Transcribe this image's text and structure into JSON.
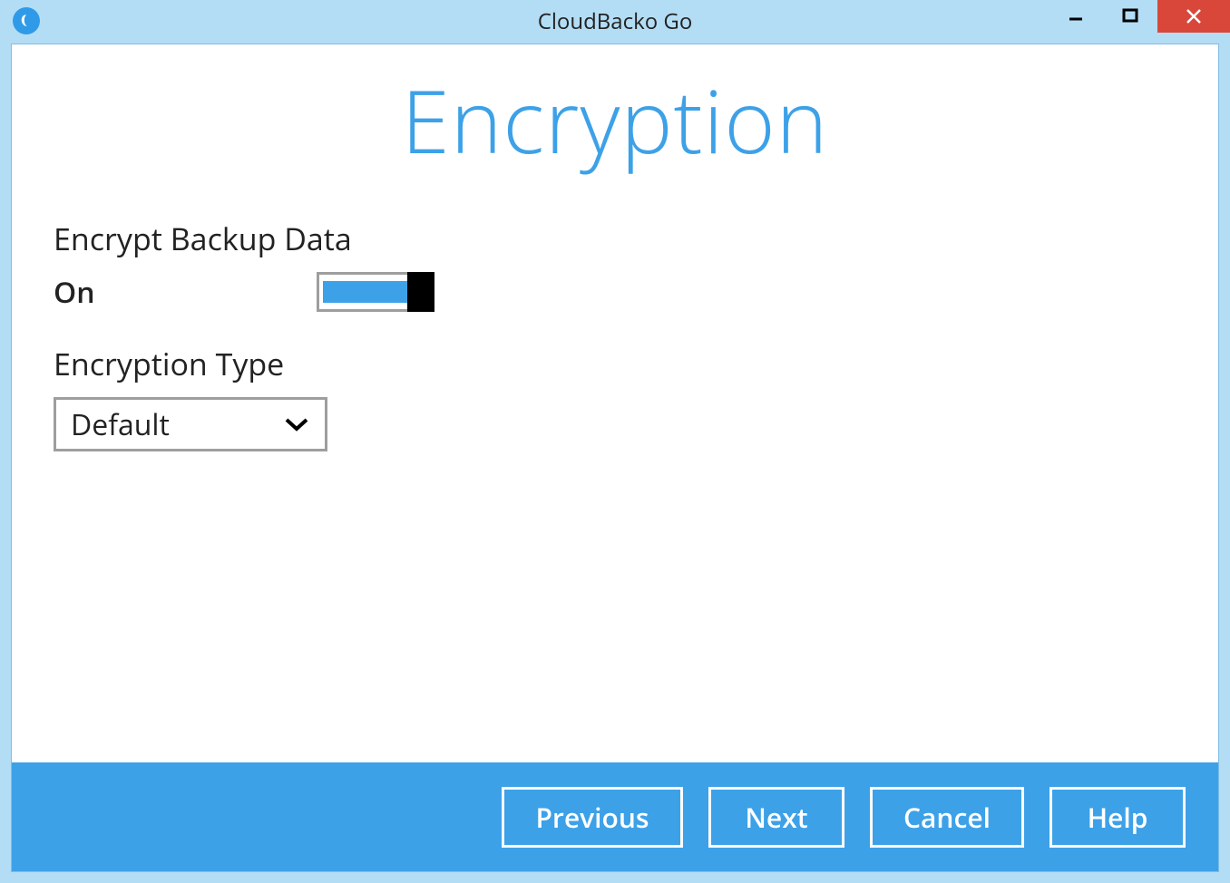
{
  "window": {
    "title": "CloudBacko Go"
  },
  "page": {
    "heading": "Encryption"
  },
  "form": {
    "encrypt_label": "Encrypt Backup Data",
    "encrypt_state": "On",
    "type_label": "Encryption Type",
    "type_value": "Default"
  },
  "footer": {
    "previous": "Previous",
    "next": "Next",
    "cancel": "Cancel",
    "help": "Help"
  },
  "icons": {
    "app": "cloudbacko-logo",
    "minimize": "minimize-icon",
    "maximize": "maximize-icon",
    "close": "close-icon",
    "chevron_down": "chevron-down-icon"
  }
}
